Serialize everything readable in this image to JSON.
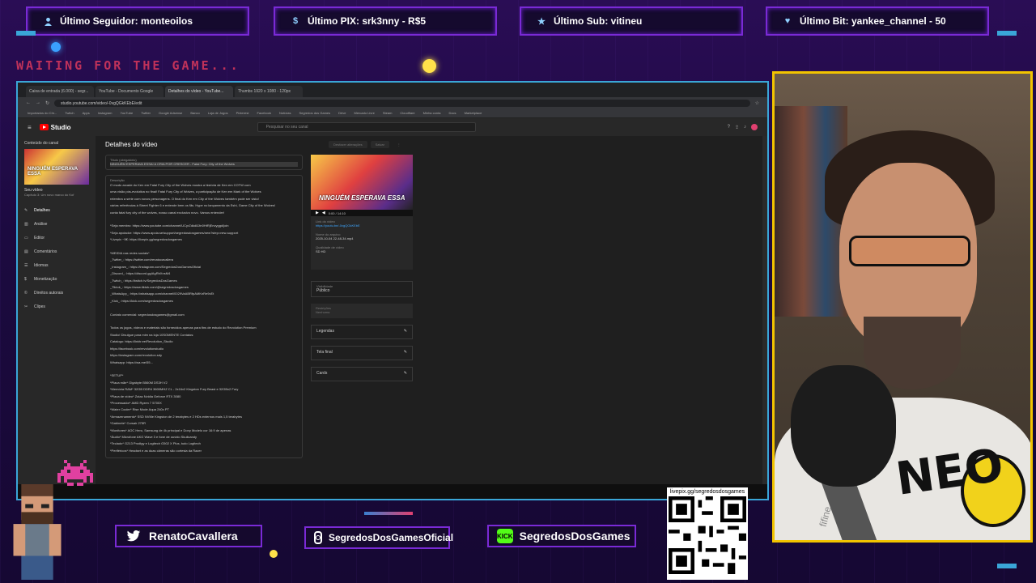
{
  "alerts": [
    {
      "icon": "user-icon",
      "text": "Último Seguidor: monteoilos"
    },
    {
      "icon": "dollar-icon",
      "text": "Último PIX: srk3nny - R$5"
    },
    {
      "icon": "star-icon",
      "text": "Último Sub: vitineu"
    },
    {
      "icon": "heart-icon",
      "text": "Último Bit: yankee_channel - 50"
    }
  ],
  "waiting_text": "WAITING FOR THE GAME...",
  "browser": {
    "tabs": [
      "Caixa de entrada (6.000) - segr...",
      "YouTube - Documento Google",
      "Detalhes do vídeo - YouTube...",
      "Thumbs 1920 x 1080 - 120px"
    ],
    "url": "studio.youtube.com/video/-0vgQGkKEbE/edit",
    "bookmarks": [
      "Importados do Chr...",
      "Twitch",
      "Apps",
      "Instagram",
      "YouTube",
      "Twitter",
      "Google Adsense",
      "Banco",
      "Loja de Jogos",
      "Pinterest",
      "Facebook",
      "Notícias",
      "Segredos dos Games",
      "Drive",
      "Mercado Livre",
      "Steam",
      "Cloudflare",
      "Minha conta",
      "Docs",
      "Marketplace"
    ]
  },
  "studio": {
    "logo": "Studio",
    "search_placeholder": "Pesquisar no seu canal",
    "sidebar": {
      "back": "Conteúdo do canal",
      "thumb_text": "NINGUÉM ESPERAVA ESSA",
      "video_label": "Seu vídeo",
      "video_sub": "Capítulo 3: Um novo marco do Kof",
      "items": [
        "Detalhes",
        "Análise",
        "Editor",
        "Comentários",
        "Idiomas",
        "Monetização",
        "Direitos autorais",
        "Clipes"
      ]
    },
    "page_title": "Detalhes do vídeo",
    "header_buttons": [
      "Desfazer alterações",
      "Salvar"
    ],
    "title_field": {
      "label": "Título (obrigatório)",
      "value": "NINGUÉM ESPERAVA ESSA! A CRIA POR CRESCER - Fatal Fury: City of the Wolves"
    },
    "description_label": "Descrição",
    "description_lines": [
      "O modo arcade do Ken em Fatal Fury City of the Wolves mostra a história de Ken em COTW com",
      "uma visão pós-evolutiva no final! Fatal Fury City of Wolves, a participação de Ken em Mark of the Wolves",
      "relembra a série com novos personagens. O final do Ken em City of the Wolves também pode ser visto!",
      "várias referências à Street Fighter 6 e entende bem os fãs. Hype no lançamento da Eshi, Game City of the Wolves!",
      "conta fatal fury city of the wolves, nosso canal exclusivo novo. Vamos entender!",
      "",
      "*Seja membro: https://www.youtube.com/channel/UCyrZdkd8Jin0HtRjEnvyggd/join",
      "*Seja apoiador: https://www.apoia.se/support/segredosdosgames/new?step=new-support",
      "*Livepix ~5€: https://livepix.gg/segredosdosgames",
      "",
      "*MEIDIA nas redes sociais*",
      "_Twitter_: https://twitter.com/renatocavallera",
      "_Instagram_: https://instagram.com/SegredosDosGamesOficial",
      "_Discord_: https://discord.gg/AgRbXnsM4",
      "_Twitch_: https://twitch.tv/SegredosDosGames",
      "_Tiktok_: https://www.tiktok.com/@segredosdosgames",
      "_WhatsApp_: https://whatsapp.com/channel/0029VaABRfpAMKnRe9vEt",
      "_Kick_: https://kick.com/segredosdosgames",
      "",
      "Contato comercial: segredosdosgames@gmail.com",
      "",
      "Todos os jogos, vídeos e materiais são fornecidos apenas para fins de estudo do Revolution Premium",
      "Studio! Divulgue para mim na loja 10SOMENTE Contatos:",
      "Catalogo: https://linktr.ee/Revolution_Studio",
      "https://facebook.com/revolutionstudio",
      "https://instagram.com/revolution.sdy",
      "Whatsapp: https://wa.me/55...",
      "",
      "*SETUP*",
      "*Placa mãe* Gigabyte B560M DS3H V2",
      "*Memória RAM* 32GB DDR4 3600MHZ CL - 2x16x2 Kingston Fury Beast e 32GBx2 Fury",
      "*Placa de vídeo* Zotac Nvidia Geforce RTX 3080",
      "*Processador* AMD Ryzen 7 5700X",
      "*Water Cooler* Rise Mode Aqua 240x PT",
      "*Armazenamento* SSD NVMe Kingston de 2 terabytes e 2 HDs externos mais 1,5 terabytes",
      "*Gabinete* Corsair 275R",
      "*Monitores* AOC Hero, Samsung de 4k principal e Dony Modelo cor 16:9 de apenas",
      "*Áudio* Microfone AKG Wave 3 e fone de ouvido Skullcandy",
      "*Teclado* G213 Prodigy e Logitech G502 X Plus, tudo Logitech",
      "*Periféricos* Headset e as duas câmeras são cortesia da Razer"
    ],
    "video_panel": {
      "thumb_text": "NINGUÉM ESPERAVA ESSA",
      "time": "0:00 / 14:10",
      "link_label": "Link do vídeo",
      "link": "https://youtu.be/-0vgQGkKEbE",
      "file_label": "Nome do arquivo",
      "file": "2025-10-04 22-48-34.mp4",
      "quality_label": "Qualidade de vídeo",
      "quality": "SD HD"
    },
    "visibility": {
      "label": "Visibilidade",
      "value": "Público"
    },
    "restrictions": {
      "label": "Restrições",
      "value": "Nenhuma"
    },
    "options": [
      "Legendas",
      "Tela final",
      "Cards"
    ]
  },
  "socials": [
    {
      "icon": "twitter-icon",
      "text": "RenatoCavallera"
    },
    {
      "icon": "instagram-icon",
      "text": "SegredosDosGamesOficial"
    },
    {
      "icon": "kick-icon",
      "badge": "KICK",
      "text": "SegredosDosGames"
    }
  ],
  "qr_url": "livepix.gg/segredosdosgames",
  "webcam": {
    "shirt_text": "NEO",
    "mic_brand": "fifine"
  },
  "colors": {
    "accent": "#7a2ad6",
    "frame": "#3aa6d8",
    "cam_border": "#f2c400",
    "waiting": "#c0325a",
    "yt_red": "#ff0000"
  }
}
